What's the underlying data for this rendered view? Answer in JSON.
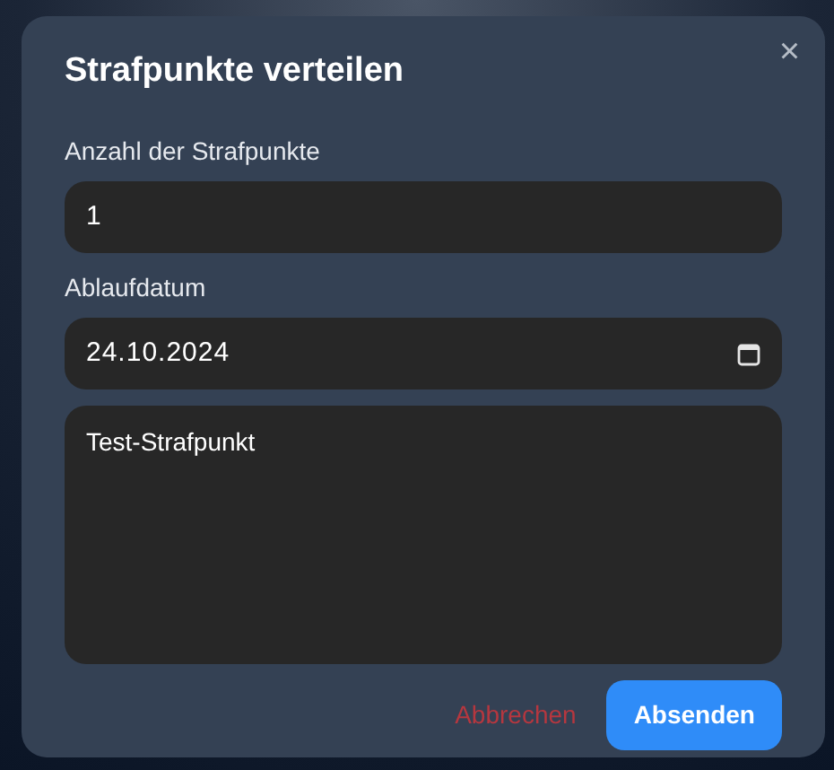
{
  "dialog": {
    "title": "Strafpunkte verteilen",
    "close_label": "×",
    "fields": [
      {
        "kind": "number",
        "label": "Anzahl der Strafpunkte",
        "value": "1"
      },
      {
        "kind": "date",
        "label": "Ablaufdatum",
        "value": "24.10.2024"
      },
      {
        "kind": "textarea",
        "value": "Test-Strafpunkt"
      }
    ],
    "buttons": [
      {
        "kind": "cancel",
        "label": "Abbrechen"
      },
      {
        "kind": "primary",
        "label": "Absenden"
      }
    ]
  }
}
